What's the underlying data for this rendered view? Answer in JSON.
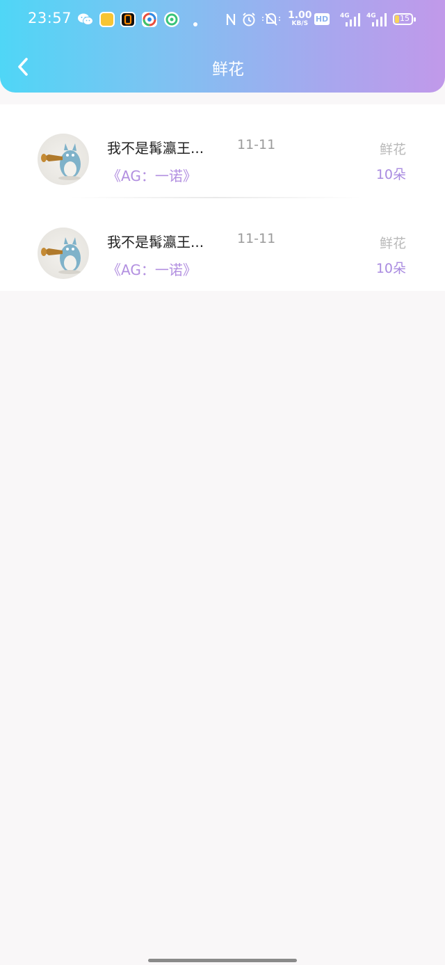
{
  "status_bar": {
    "time": "23:57",
    "net_speed_value": "1.00",
    "net_speed_unit": "KB/S",
    "hd_label": "HD",
    "sim1_type": "4G",
    "sim2_type": "4G",
    "battery_level": "15",
    "icons": [
      "wechat-icon",
      "notes-app-icon",
      "orange-app-icon",
      "browser-app-icon",
      "green-app-icon",
      "dot-icon",
      "nfc-icon",
      "alarm-icon",
      "mute-icon"
    ]
  },
  "header": {
    "title": "鲜花",
    "back_icon": "chevron-left-icon",
    "gradient_start": "#4fd6f6",
    "gradient_end": "#c199ea"
  },
  "records": [
    {
      "user": "我不是髯瀛王...",
      "date": "11-11",
      "book": "《AG：一诺》",
      "gift_type": "鲜花",
      "count": "10朵"
    },
    {
      "user": "我不是髯瀛王...",
      "date": "11-11",
      "book": "《AG：一诺》",
      "gift_type": "鲜花",
      "count": "10朵"
    }
  ],
  "colors": {
    "accent_purple": "#b28fe0",
    "page_bg": "#f9f7f8"
  }
}
